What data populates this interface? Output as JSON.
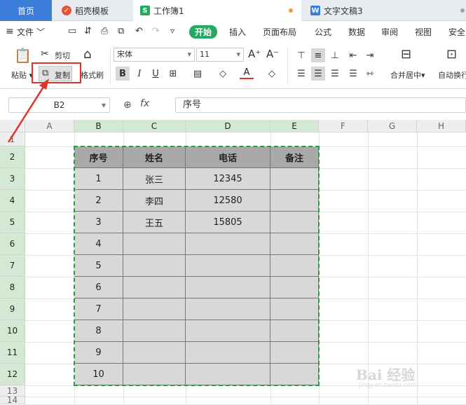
{
  "tabs": {
    "home": "首页",
    "template": "稻壳模板",
    "workbook": "工作簿1",
    "doc": "文字文稿3"
  },
  "menu": {
    "file": "文件",
    "start": "开始",
    "insert": "插入",
    "layout": "页面布局",
    "formula": "公式",
    "data": "数据",
    "review": "审阅",
    "view": "视图",
    "security": "安全"
  },
  "ribbon": {
    "paste": "粘贴",
    "cut": "剪切",
    "copy": "复制",
    "format_painter": "格式刷",
    "font_name": "宋体",
    "font_size": "11",
    "merge_center": "合并居中",
    "auto_wrap": "自动换行"
  },
  "formula_bar": {
    "cell_ref": "B2",
    "fx": "fx",
    "content": "序号"
  },
  "sheet": {
    "columns": [
      "A",
      "B",
      "C",
      "D",
      "E",
      "F",
      "G",
      "H"
    ],
    "rows": [
      "1",
      "2",
      "3",
      "4",
      "5",
      "6",
      "7",
      "8",
      "9",
      "10",
      "11",
      "12",
      "13",
      "14"
    ],
    "header": [
      "序号",
      "姓名",
      "电话",
      "备注"
    ],
    "data": [
      [
        "1",
        "张三",
        "12345",
        ""
      ],
      [
        "2",
        "李四",
        "12580",
        ""
      ],
      [
        "3",
        "王五",
        "15805",
        ""
      ],
      [
        "4",
        "",
        "",
        ""
      ],
      [
        "5",
        "",
        "",
        ""
      ],
      [
        "6",
        "",
        "",
        ""
      ],
      [
        "7",
        "",
        "",
        ""
      ],
      [
        "8",
        "",
        "",
        ""
      ],
      [
        "9",
        "",
        "",
        ""
      ],
      [
        "10",
        "",
        "",
        ""
      ]
    ]
  },
  "watermark": "Bai 经验",
  "watermark_sub": "jingyan.baidu.com",
  "colors": {
    "accent_blue": "#3c7dd9",
    "start_green": "#27a862",
    "selection_green": "#26a03c",
    "annotation_red": "#e0332c"
  }
}
